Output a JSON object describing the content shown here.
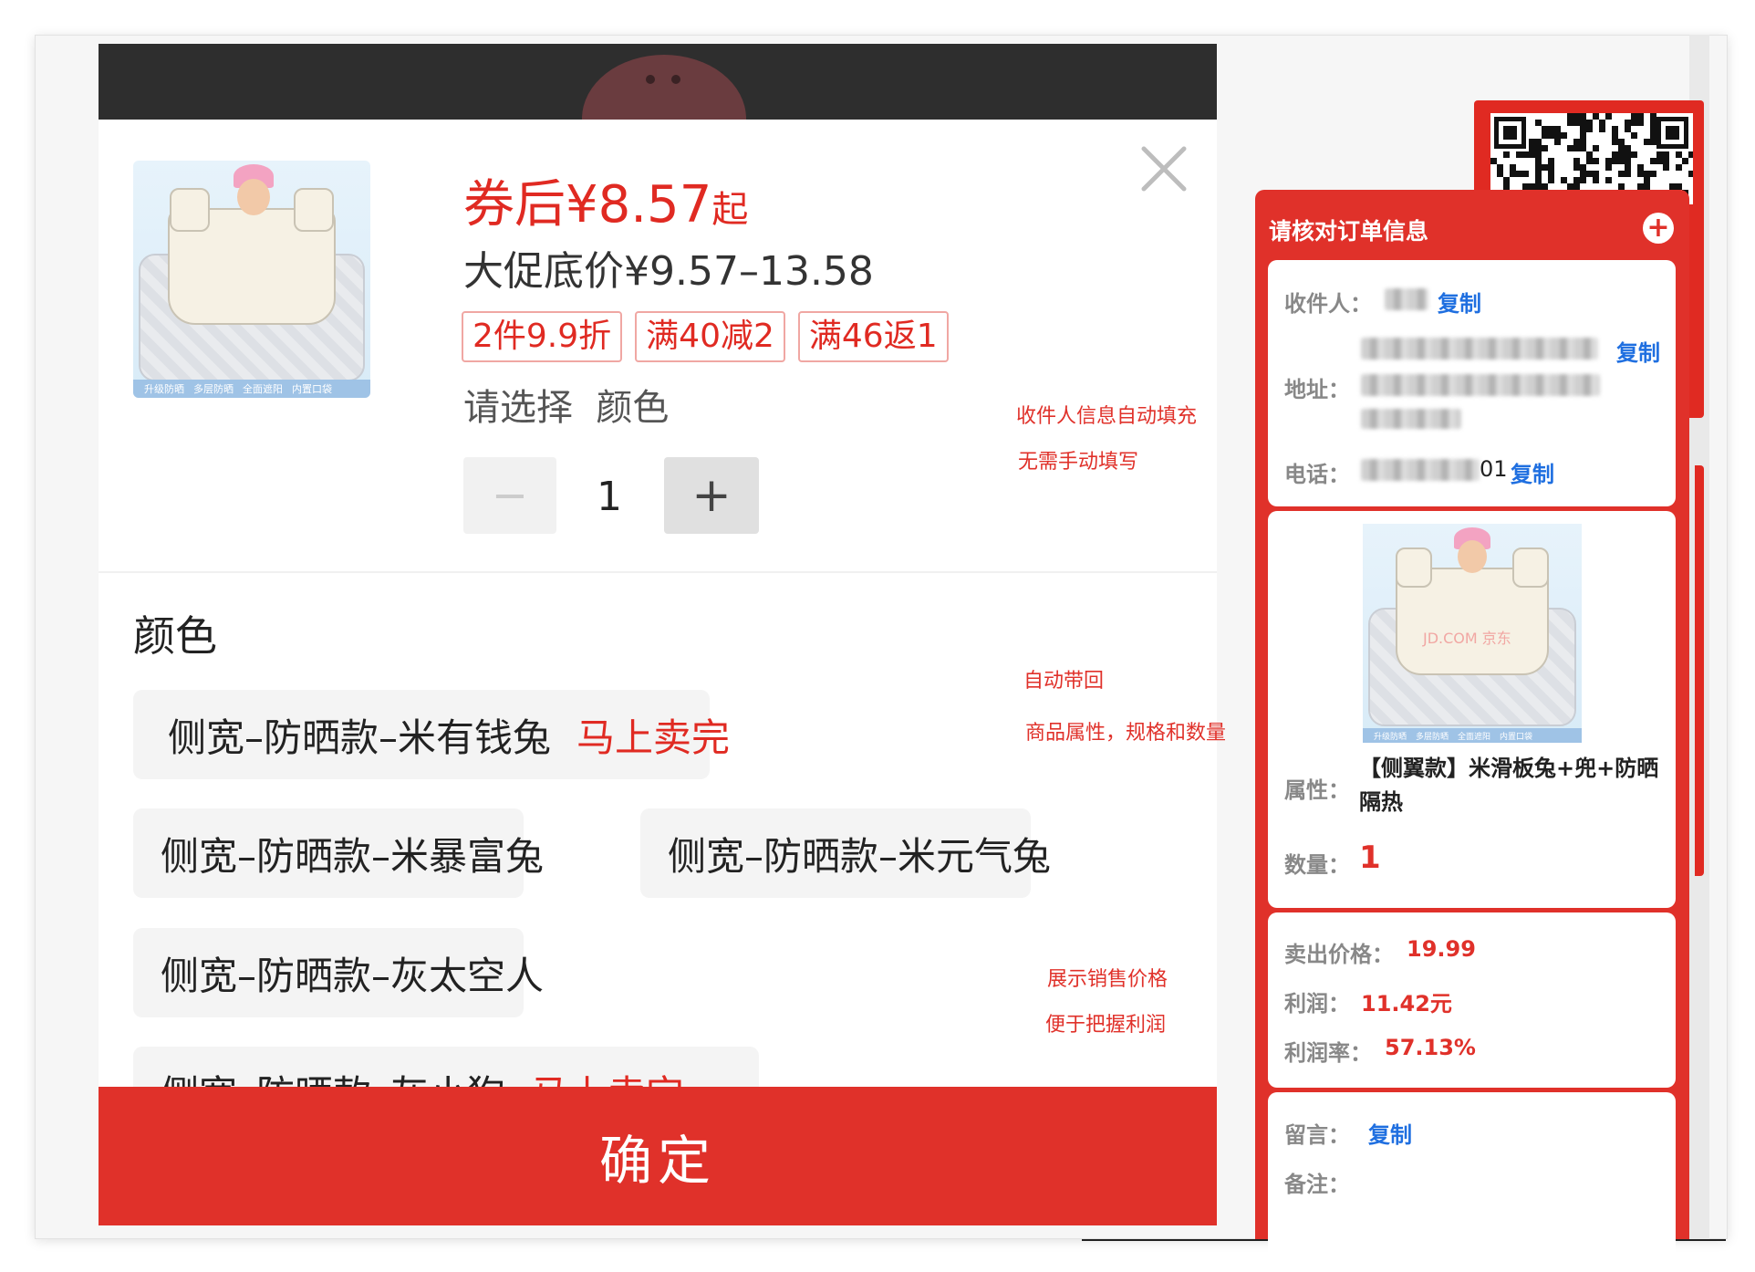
{
  "product": {
    "price_after_coupon": "券后¥8.57",
    "price_after_suffix": "起",
    "promo_price_range": "大促底价¥9.57–13.58",
    "promo_tags": [
      "2件9.9折",
      "满40减2",
      "满46返1"
    ],
    "choose_prompt": "请选择  颜色",
    "quantity": "1",
    "minus_symbol": "−",
    "plus_symbol": "+",
    "thumb_strip": [
      "升级防晒",
      "多层防晒",
      "全面遮阳",
      "内置口袋"
    ]
  },
  "color_section": {
    "title": "颜色",
    "options": [
      {
        "label": "侧宽–防晒款–米有钱兔",
        "badge": "马上卖完",
        "hot": true
      },
      {
        "label": "侧宽–防晒款–米暴富兔",
        "badge": "",
        "hot": false
      },
      {
        "label": "侧宽–防晒款–米元气兔",
        "badge": "",
        "hot": false
      },
      {
        "label": "侧宽–防晒款–灰太空人",
        "badge": "",
        "hot": false
      },
      {
        "label": "侧宽–防晒款–灰小狗",
        "badge": "马上卖完",
        "hot": false
      }
    ]
  },
  "confirm_label": "确定",
  "annotations": {
    "note1_line1": "收件人信息自动填充",
    "note1_line2": "无需手动填写",
    "note2_line1": "自动带回",
    "note2_line2": "商品属性，规格和数量",
    "note3_line1": "展示销售价格",
    "note3_line2": "便于把握利润"
  },
  "order_panel": {
    "title": "请核对订单信息",
    "add_symbol": "+",
    "receiver_label": "收件人：",
    "address_label": "地址：",
    "phone_label": "电话：",
    "phone_visible_suffix": "01",
    "copy_label": "复制",
    "attr_label": "属性：",
    "attr_value": "【侧翼款】米滑板兔+兜+防晒隔热",
    "qty_label": "数量：",
    "qty_value": "1",
    "sell_price_label": "卖出价格：",
    "sell_price_value": "19.99",
    "profit_label": "利润：",
    "profit_value": "11.42元",
    "profit_rate_label": "利润率：",
    "profit_rate_value": "57.13%",
    "message_label": "留言：",
    "remark_label": "备注：",
    "image_watermark": "JD.COM 京东"
  },
  "colors": {
    "accent_red": "#e0312a",
    "link_blue": "#1f6fe0",
    "text_dark": "#222222"
  }
}
